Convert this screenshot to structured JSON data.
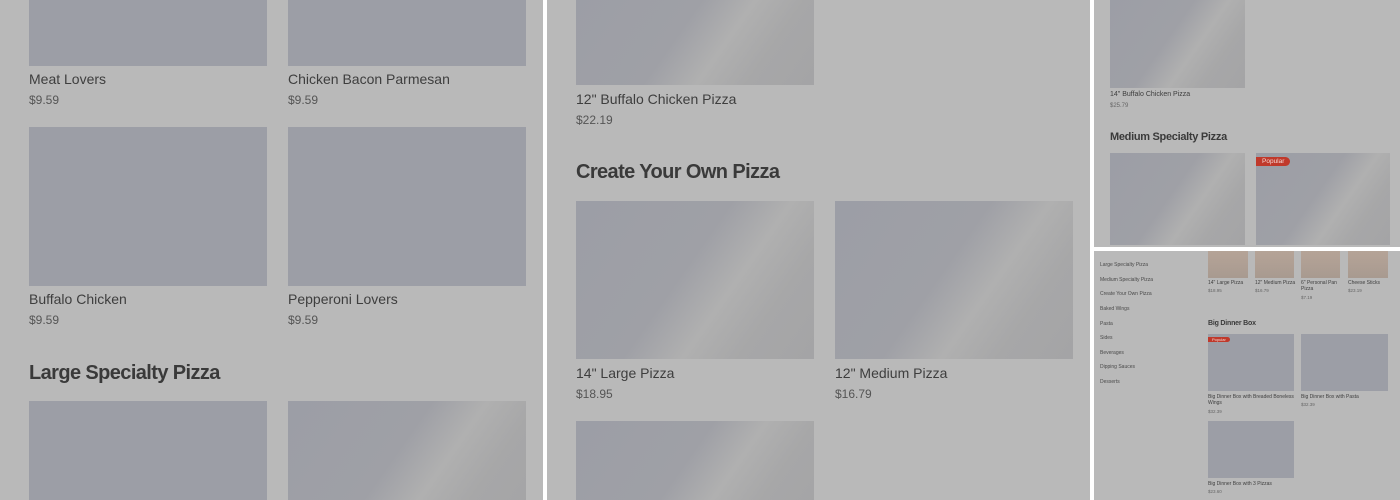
{
  "panel1": {
    "top_cards": [
      {
        "name": "Meat Lovers",
        "price": "$9.59"
      },
      {
        "name": "Chicken Bacon Parmesan",
        "price": "$9.59"
      }
    ],
    "mid_cards": [
      {
        "name": "Buffalo Chicken",
        "price": "$9.59"
      },
      {
        "name": "Pepperoni Lovers",
        "price": "$9.59"
      }
    ],
    "section_title": "Large Specialty Pizza"
  },
  "panel2": {
    "top_card": {
      "name": "12\" Buffalo Chicken Pizza",
      "price": "$22.19"
    },
    "section_title": "Create Your Own Pizza",
    "cards": [
      {
        "name": "14\" Large Pizza",
        "price": "$18.95"
      },
      {
        "name": "12\" Medium Pizza",
        "price": "$16.79"
      }
    ]
  },
  "panel3": {
    "top_card": {
      "name": "14\" Buffalo Chicken Pizza",
      "price": "$25.79"
    },
    "section_title": "Medium Specialty Pizza",
    "badge": "Popular"
  },
  "panel4": {
    "sidebar": [
      "Large Specialty Pizza",
      "Medium Specialty Pizza",
      "Create Your Own Pizza",
      "Baked Wings",
      "Pasta",
      "Sides",
      "Beverages",
      "Dipping Sauces",
      "Desserts"
    ],
    "top_items": [
      {
        "name": "14\" Large Pizza",
        "price": "$18.95"
      },
      {
        "name": "12\" Medium Pizza",
        "price": "$16.79"
      },
      {
        "name": "6\" Personal Pan Pizza",
        "price": "$7.19"
      },
      {
        "name": "Cheese Sticks",
        "price": "$23.19"
      }
    ],
    "section_title": "Big Dinner Box",
    "badge": "Popular",
    "boxes": [
      {
        "name": "Big Dinner Box with Breaded Boneless Wings",
        "price": "$32.39"
      },
      {
        "name": "Big Dinner Box with Pasta",
        "price": "$32.39"
      },
      {
        "name": "Big Dinner Box with 3 Pizzas",
        "price": "$23.60"
      }
    ]
  },
  "colors": {
    "panel_bg": "#b9b9b9",
    "image_placeholder": "#9c9ea6",
    "badge": "#c0392b",
    "divider": "#ffffff"
  }
}
